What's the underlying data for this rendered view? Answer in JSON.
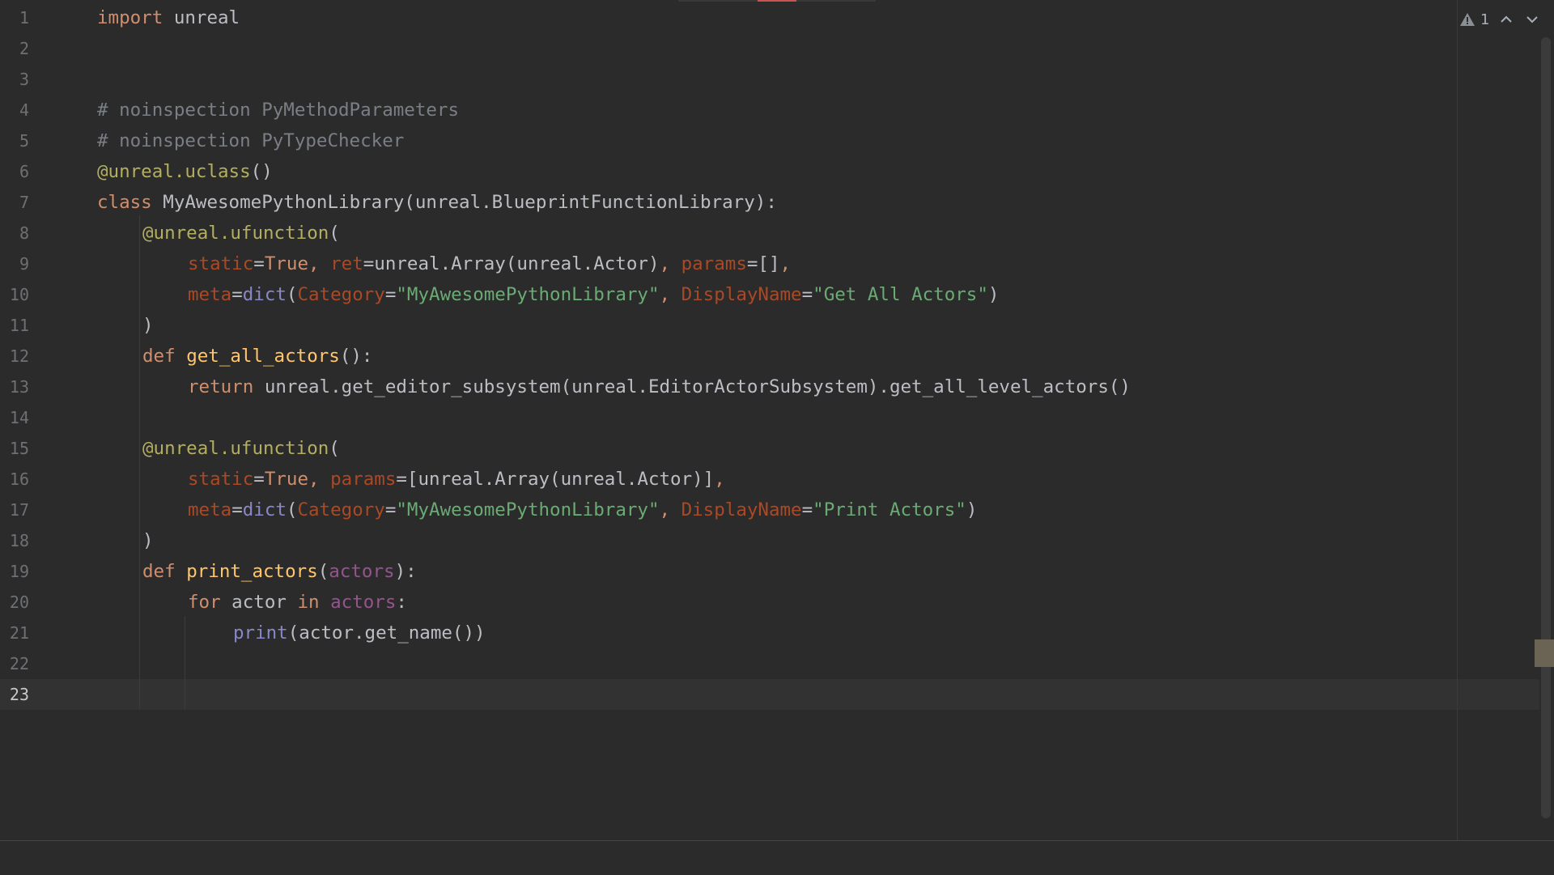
{
  "gutter": {
    "line_numbers": [
      "1",
      "2",
      "3",
      "4",
      "5",
      "6",
      "7",
      "8",
      "9",
      "10",
      "11",
      "12",
      "13",
      "14",
      "15",
      "16",
      "17",
      "18",
      "19",
      "20",
      "21",
      "22",
      "23"
    ]
  },
  "inspection": {
    "warning_count": "1",
    "warning_icon": "warning-triangle-icon",
    "prev_icon": "chevron-up-icon",
    "next_icon": "chevron-down-icon"
  },
  "code": {
    "l1": {
      "kw": "import",
      "rest": " unreal"
    },
    "l4": {
      "comment": "# noinspection PyMethodParameters"
    },
    "l5": {
      "comment": "# noinspection PyTypeChecker"
    },
    "l6": {
      "dec": "@unreal.uclass",
      "rest": "()"
    },
    "l7": {
      "kw": "class",
      "rest": " MyAwesomePythonLibrary(unreal.BlueprintFunctionLibrary):"
    },
    "l8": {
      "dec": "@unreal.ufunction",
      "rest": "("
    },
    "l9": {
      "p1": "static",
      "eq1": "=",
      "v1": "True",
      "c1": ", ",
      "p2": "ret",
      "eq2": "=",
      "v2": "unreal.Array(unreal.Actor)",
      "c2": ", ",
      "p3": "params",
      "eq3": "=",
      "v3": "[]",
      "c3": ","
    },
    "l10": {
      "p1": "meta",
      "eq1": "=",
      "b1": "dict",
      "o1": "(",
      "p2": "Category",
      "eq2": "=",
      "s1": "\"MyAwesomePythonLibrary\"",
      "c1": ", ",
      "p3": "DisplayName",
      "eq3": "=",
      "s2": "\"Get All Actors\"",
      "close": ")"
    },
    "l11": {
      "rest": ")"
    },
    "l12": {
      "kw": "def",
      "sp": " ",
      "fn": "get_all_actors",
      "rest": "():"
    },
    "l13": {
      "kw": "return",
      "rest": " unreal.get_editor_subsystem(unreal.EditorActorSubsystem).get_all_level_actors()"
    },
    "l15": {
      "dec": "@unreal.ufunction",
      "rest": "("
    },
    "l16": {
      "p1": "static",
      "eq1": "=",
      "v1": "True",
      "c1": ", ",
      "p2": "params",
      "eq2": "=",
      "v2": "[unreal.Array(unreal.Actor)]",
      "c2": ","
    },
    "l17": {
      "p1": "meta",
      "eq1": "=",
      "b1": "dict",
      "o1": "(",
      "p2": "Category",
      "eq2": "=",
      "s1": "\"MyAwesomePythonLibrary\"",
      "c1": ", ",
      "p3": "DisplayName",
      "eq3": "=",
      "s2": "\"Print Actors\"",
      "close": ")"
    },
    "l18": {
      "rest": ")"
    },
    "l19": {
      "kw": "def",
      "sp": " ",
      "fn": "print_actors",
      "o": "(",
      "param": "actors",
      "rest": "):"
    },
    "l20": {
      "kw": "for",
      "a": " actor ",
      "kw2": "in",
      "sp": " ",
      "param": "actors",
      "rest": ":"
    },
    "l21": {
      "builtin": "print",
      "rest": "(actor.get_name())"
    }
  },
  "colors": {
    "background": "#2b2b2b",
    "keyword": "#cf8e6d",
    "string": "#6aab73",
    "comment": "#7a7e85",
    "decorator": "#b3ae60",
    "named_param": "#aa4926",
    "builtin": "#8888c6",
    "function_def": "#ffc66d",
    "parameter": "#94558d"
  }
}
